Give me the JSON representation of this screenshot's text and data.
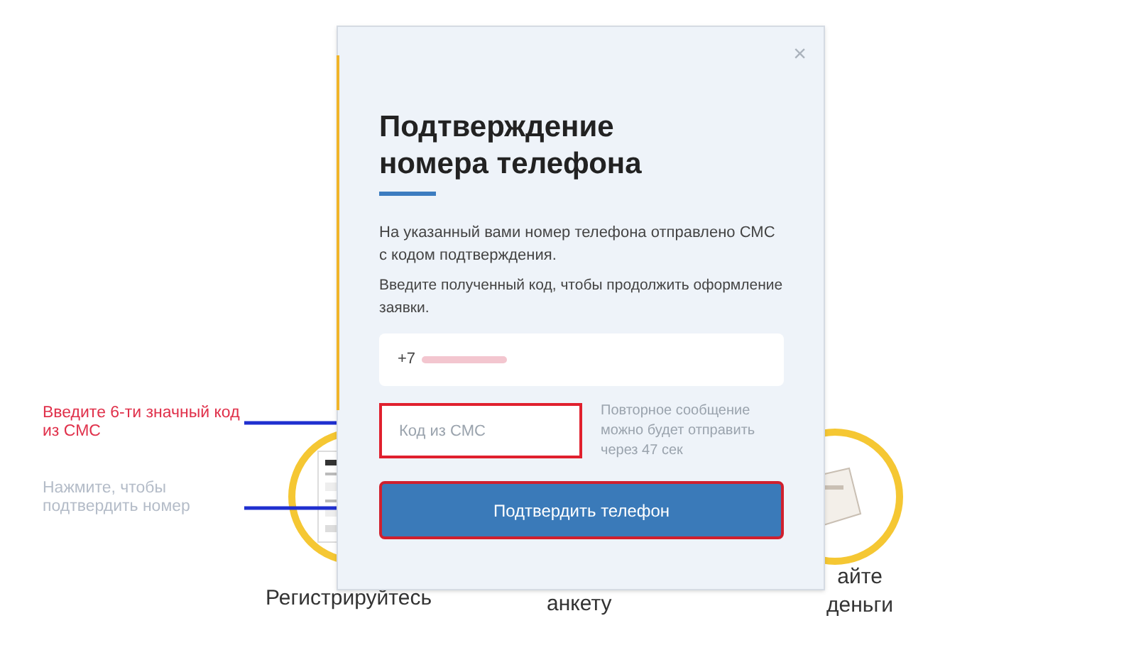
{
  "background_steps": [
    {
      "label": "Регистрируйтесь",
      "kind": "document"
    },
    {
      "label": "анкету"
    },
    {
      "label": "айте\nденьги",
      "kind": "money"
    }
  ],
  "annotations": [
    {
      "text": "Введите 6-ти значный код из СМС",
      "faded": false
    },
    {
      "text": "Нажмите, чтобы подтвердить номер",
      "faded": true
    }
  ],
  "modal": {
    "close": "×",
    "title": "Подтверждение номера телефона",
    "message": "На указанный вами номер телефона отправлено СМС с кодом подтверждения.",
    "instruction": "Введите полученный код, чтобы продолжить оформление заявки.",
    "phone_field": {
      "value": "+7"
    },
    "code_field": {
      "placeholder": "Код из СМС",
      "highlighted": true
    },
    "resend_hint": "Повторное сообщение можно будет отправить через 47 сек",
    "submit_button": {
      "label": "Подтвердить телефон",
      "highlighted": true
    }
  }
}
